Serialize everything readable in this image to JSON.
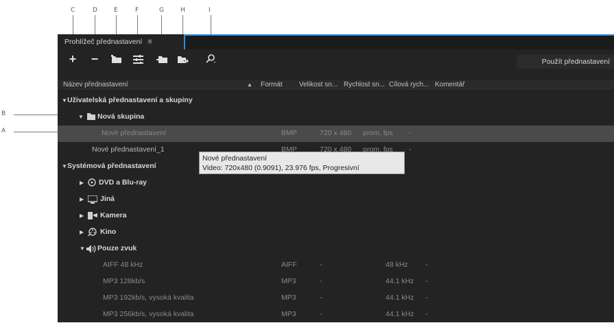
{
  "callouts": [
    "C",
    "D",
    "E",
    "F",
    "G",
    "H",
    "I",
    "B",
    "A"
  ],
  "panel": {
    "tab_title": "Prohlížeč přednastavení",
    "tab_menu_icon": "≡"
  },
  "toolbar": {
    "add": "+",
    "remove": "−",
    "new_group": "new-folder-icon",
    "preset_settings": "sliders-icon",
    "import": "import-icon",
    "export": "export-icon",
    "search": "search-icon",
    "apply_label": "Použít přednastavení"
  },
  "columns": {
    "name": "Název přednastavení",
    "sort": "▲",
    "format": "Formát",
    "size": "Velikost sn...",
    "fps": "Rychlost sn...",
    "target": "Cílová rych...",
    "comment": "Komentář"
  },
  "rows": {
    "user_group": "Uživatelská přednastavení a skupiny",
    "new_group": "Nová skupina",
    "preset1": {
      "name": "Nové přednastavení",
      "format": "BMP",
      "size": "720 x 480",
      "fps": "prom. fps",
      "target": "-"
    },
    "preset2": {
      "name": "Nové přednastavení_1",
      "format": "BMP",
      "size": "720 x 480",
      "fps": "prom. fps",
      "target": "-"
    },
    "system": "Systémová přednastavení",
    "dvd": "DVD a Blu-ray",
    "other": "Jiná",
    "camera": "Kamera",
    "cinema": "Kino",
    "audio": "Pouze zvuk",
    "audio_items": [
      {
        "name": "AIFF 48 kHz",
        "format": "AIFF",
        "size": "-",
        "fps": "48  kHz",
        "target": "-"
      },
      {
        "name": "MP3 128kb/s",
        "format": "MP3",
        "size": "-",
        "fps": "44.1  kHz",
        "target": "-"
      },
      {
        "name": "MP3 192kb/s, vysoká kvalita",
        "format": "MP3",
        "size": "-",
        "fps": "44.1  kHz",
        "target": "-"
      },
      {
        "name": "MP3 256kb/s, vysoká kvalita",
        "format": "MP3",
        "size": "-",
        "fps": "44.1  kHz",
        "target": "-"
      }
    ]
  },
  "tooltip": {
    "line1": "Nové přednastavení",
    "line2": "Video: 720x480 (0.9091), 23.976 fps, Progresivní"
  }
}
